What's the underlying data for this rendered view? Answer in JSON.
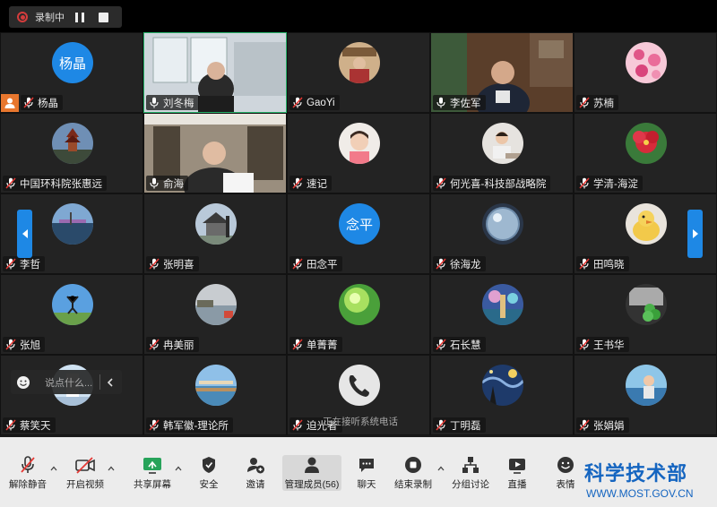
{
  "recording": {
    "label": "录制中"
  },
  "tiles": [
    {
      "name": "杨晶",
      "avatar_text": "杨晶",
      "kind": "text",
      "mic": "muted",
      "host": true
    },
    {
      "name": "刘冬梅",
      "kind": "video",
      "scene": "office-window",
      "mic": "on",
      "active": true
    },
    {
      "name": "GaoYi",
      "kind": "photo",
      "scene": "reading",
      "mic": "muted"
    },
    {
      "name": "李佐军",
      "kind": "video",
      "scene": "office-suit",
      "mic": "on"
    },
    {
      "name": "苏楠",
      "kind": "photo",
      "scene": "pink-flowers",
      "mic": "muted"
    },
    {
      "name": "中国环科院张惠远",
      "kind": "photo",
      "scene": "tower",
      "mic": "muted"
    },
    {
      "name": "俞海",
      "kind": "video",
      "scene": "bookshelf-man",
      "mic": "on"
    },
    {
      "name": "速记",
      "kind": "photo",
      "scene": "girl",
      "mic": "muted"
    },
    {
      "name": "何光喜-科技部战略院",
      "kind": "photo",
      "scene": "kid-writing",
      "mic": "muted"
    },
    {
      "name": "学清-海淀",
      "kind": "photo",
      "scene": "red-flower",
      "mic": "muted"
    },
    {
      "name": "李哲",
      "kind": "photo",
      "scene": "lakeside",
      "mic": "muted"
    },
    {
      "name": "张明喜",
      "kind": "photo",
      "scene": "pavilion",
      "mic": "muted"
    },
    {
      "name": "田念平",
      "avatar_text": "念平",
      "kind": "text",
      "mic": "muted"
    },
    {
      "name": "徐海龙",
      "kind": "photo",
      "scene": "bubble",
      "mic": "muted"
    },
    {
      "name": "田鸣晓",
      "kind": "photo",
      "scene": "duck",
      "mic": "muted"
    },
    {
      "name": "张旭",
      "kind": "photo",
      "scene": "jump",
      "mic": "muted"
    },
    {
      "name": "冉美丽",
      "kind": "photo",
      "scene": "lake-grey",
      "mic": "muted"
    },
    {
      "name": "单菁菁",
      "kind": "photo",
      "scene": "green-light",
      "mic": "muted"
    },
    {
      "name": "石长慧",
      "kind": "photo",
      "scene": "painting",
      "mic": "muted"
    },
    {
      "name": "王书华",
      "kind": "photo",
      "scene": "clover",
      "mic": "muted"
    },
    {
      "name": "蔡笑天",
      "kind": "photo",
      "scene": "sky-white",
      "mic": "muted"
    },
    {
      "name": "韩军徽-理论所",
      "kind": "photo",
      "scene": "pier",
      "mic": "muted"
    },
    {
      "name": "迫光者",
      "kind": "photo",
      "scene": "phone",
      "mic": "muted"
    },
    {
      "name": "丁明磊",
      "kind": "photo",
      "scene": "starry-night",
      "mic": "muted"
    },
    {
      "name": "张娟娟",
      "kind": "photo",
      "scene": "child-sea",
      "mic": "muted"
    }
  ],
  "chat": {
    "placeholder": "说点什么..."
  },
  "phone_tip": "正在接听系统电话",
  "toolbar": {
    "unmute": "解除静音",
    "start_video": "开启视频",
    "share_screen": "共享屏幕",
    "security": "安全",
    "invite": "邀请",
    "manage_members": "管理成员(56)",
    "chat": "聊天",
    "end_recording": "结束录制",
    "breakout": "分组讨论",
    "live": "直播",
    "reactions": "表情"
  },
  "brand": {
    "name": "科学技术部",
    "url": "WWW.MOST.GOV.CN",
    "color": "#1565c0"
  },
  "colors": {
    "accent": "#1e88e5",
    "host": "#e8772e",
    "active_border": "#27b36a",
    "recording": "#d43c3c"
  }
}
